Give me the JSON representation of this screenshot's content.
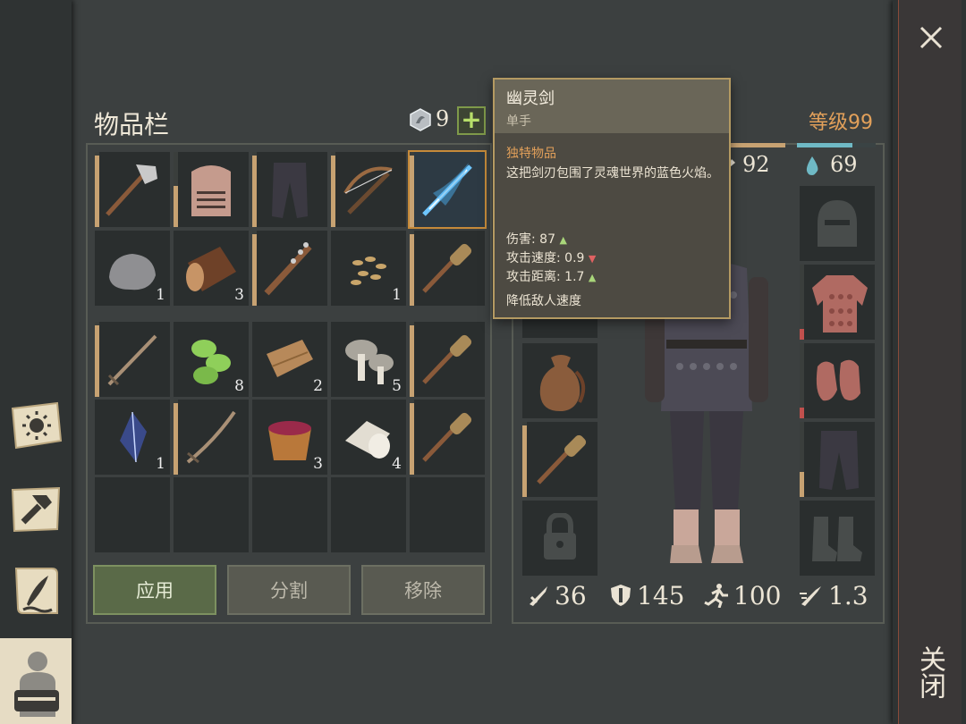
{
  "inventory": {
    "title": "物品栏",
    "currency": "9",
    "add_label": "+",
    "rows": [
      [
        {
          "icon": "stone-hammer-icon",
          "count": "",
          "durability": 0.95
        },
        {
          "icon": "knight-helmet-icon",
          "count": "",
          "durability": 0.55
        },
        {
          "icon": "pants-icon",
          "count": "",
          "durability": 0.95
        },
        {
          "icon": "crossbow-icon",
          "count": "",
          "durability": 0.95
        },
        {
          "icon": "phantom-sword-icon",
          "count": "",
          "durability": 0.95,
          "selected": true
        }
      ],
      [
        {
          "icon": "stone-icon",
          "count": "1"
        },
        {
          "icon": "wood-log-icon",
          "count": "3"
        },
        {
          "icon": "spiked-club-icon",
          "count": "",
          "durability": 0.95
        },
        {
          "icon": "seeds-icon",
          "count": "1"
        },
        {
          "icon": "wooden-club-icon",
          "count": "",
          "durability": 0.95
        }
      ],
      [
        {
          "icon": "straight-sword-icon",
          "count": "",
          "durability": 0.95
        },
        {
          "icon": "cucumber-slices-icon",
          "count": "8"
        },
        {
          "icon": "leather-scrap-icon",
          "count": "2"
        },
        {
          "icon": "mushrooms-icon",
          "count": "5"
        },
        {
          "icon": "wooden-club-icon",
          "count": "",
          "durability": 0.95
        }
      ],
      [
        {
          "icon": "soul-crystal-icon",
          "count": "1"
        },
        {
          "icon": "curved-sword-icon",
          "count": "",
          "durability": 0.95
        },
        {
          "icon": "berry-bowl-icon",
          "count": "3"
        },
        {
          "icon": "cloth-roll-icon",
          "count": "4"
        },
        {
          "icon": "wooden-club-icon",
          "count": "",
          "durability": 0.95
        }
      ],
      [
        {
          "icon": "",
          "count": ""
        },
        {
          "icon": "",
          "count": ""
        },
        {
          "icon": "",
          "count": ""
        },
        {
          "icon": "",
          "count": ""
        },
        {
          "icon": "",
          "count": ""
        }
      ]
    ],
    "buttons": {
      "apply": "应用",
      "split": "分割",
      "remove": "移除"
    }
  },
  "character": {
    "level_label": "等级99",
    "food_value": "92",
    "water_value": "69",
    "stats": {
      "attack": "36",
      "armor": "145",
      "speed": "100",
      "attack_speed": "1.3"
    }
  },
  "tooltip": {
    "name": "幽灵剑",
    "type": "单手",
    "rarity": "独特物品",
    "description": "这把剑刃包围了灵魂世界的蓝色火焰。",
    "damage": "伤害: 87",
    "attack_speed": "攻击速度: 0.9",
    "attack_range": "攻击距离: 1.7",
    "effect": "降低敌人速度",
    "up_arrow": "▲",
    "down_arrow": "▼"
  },
  "sidebar": [
    {
      "icon": "sun-map-icon"
    },
    {
      "icon": "crafting-hammer-icon"
    },
    {
      "icon": "quest-scroll-icon"
    },
    {
      "icon": "character-backpack-icon",
      "active": true
    }
  ],
  "close": {
    "icon": "close-icon",
    "label": "关闭"
  },
  "colors": {
    "accent": "#e2a05a",
    "durability": "#c7a272",
    "water": "#6fb9c5",
    "danger": "#c0504d"
  }
}
